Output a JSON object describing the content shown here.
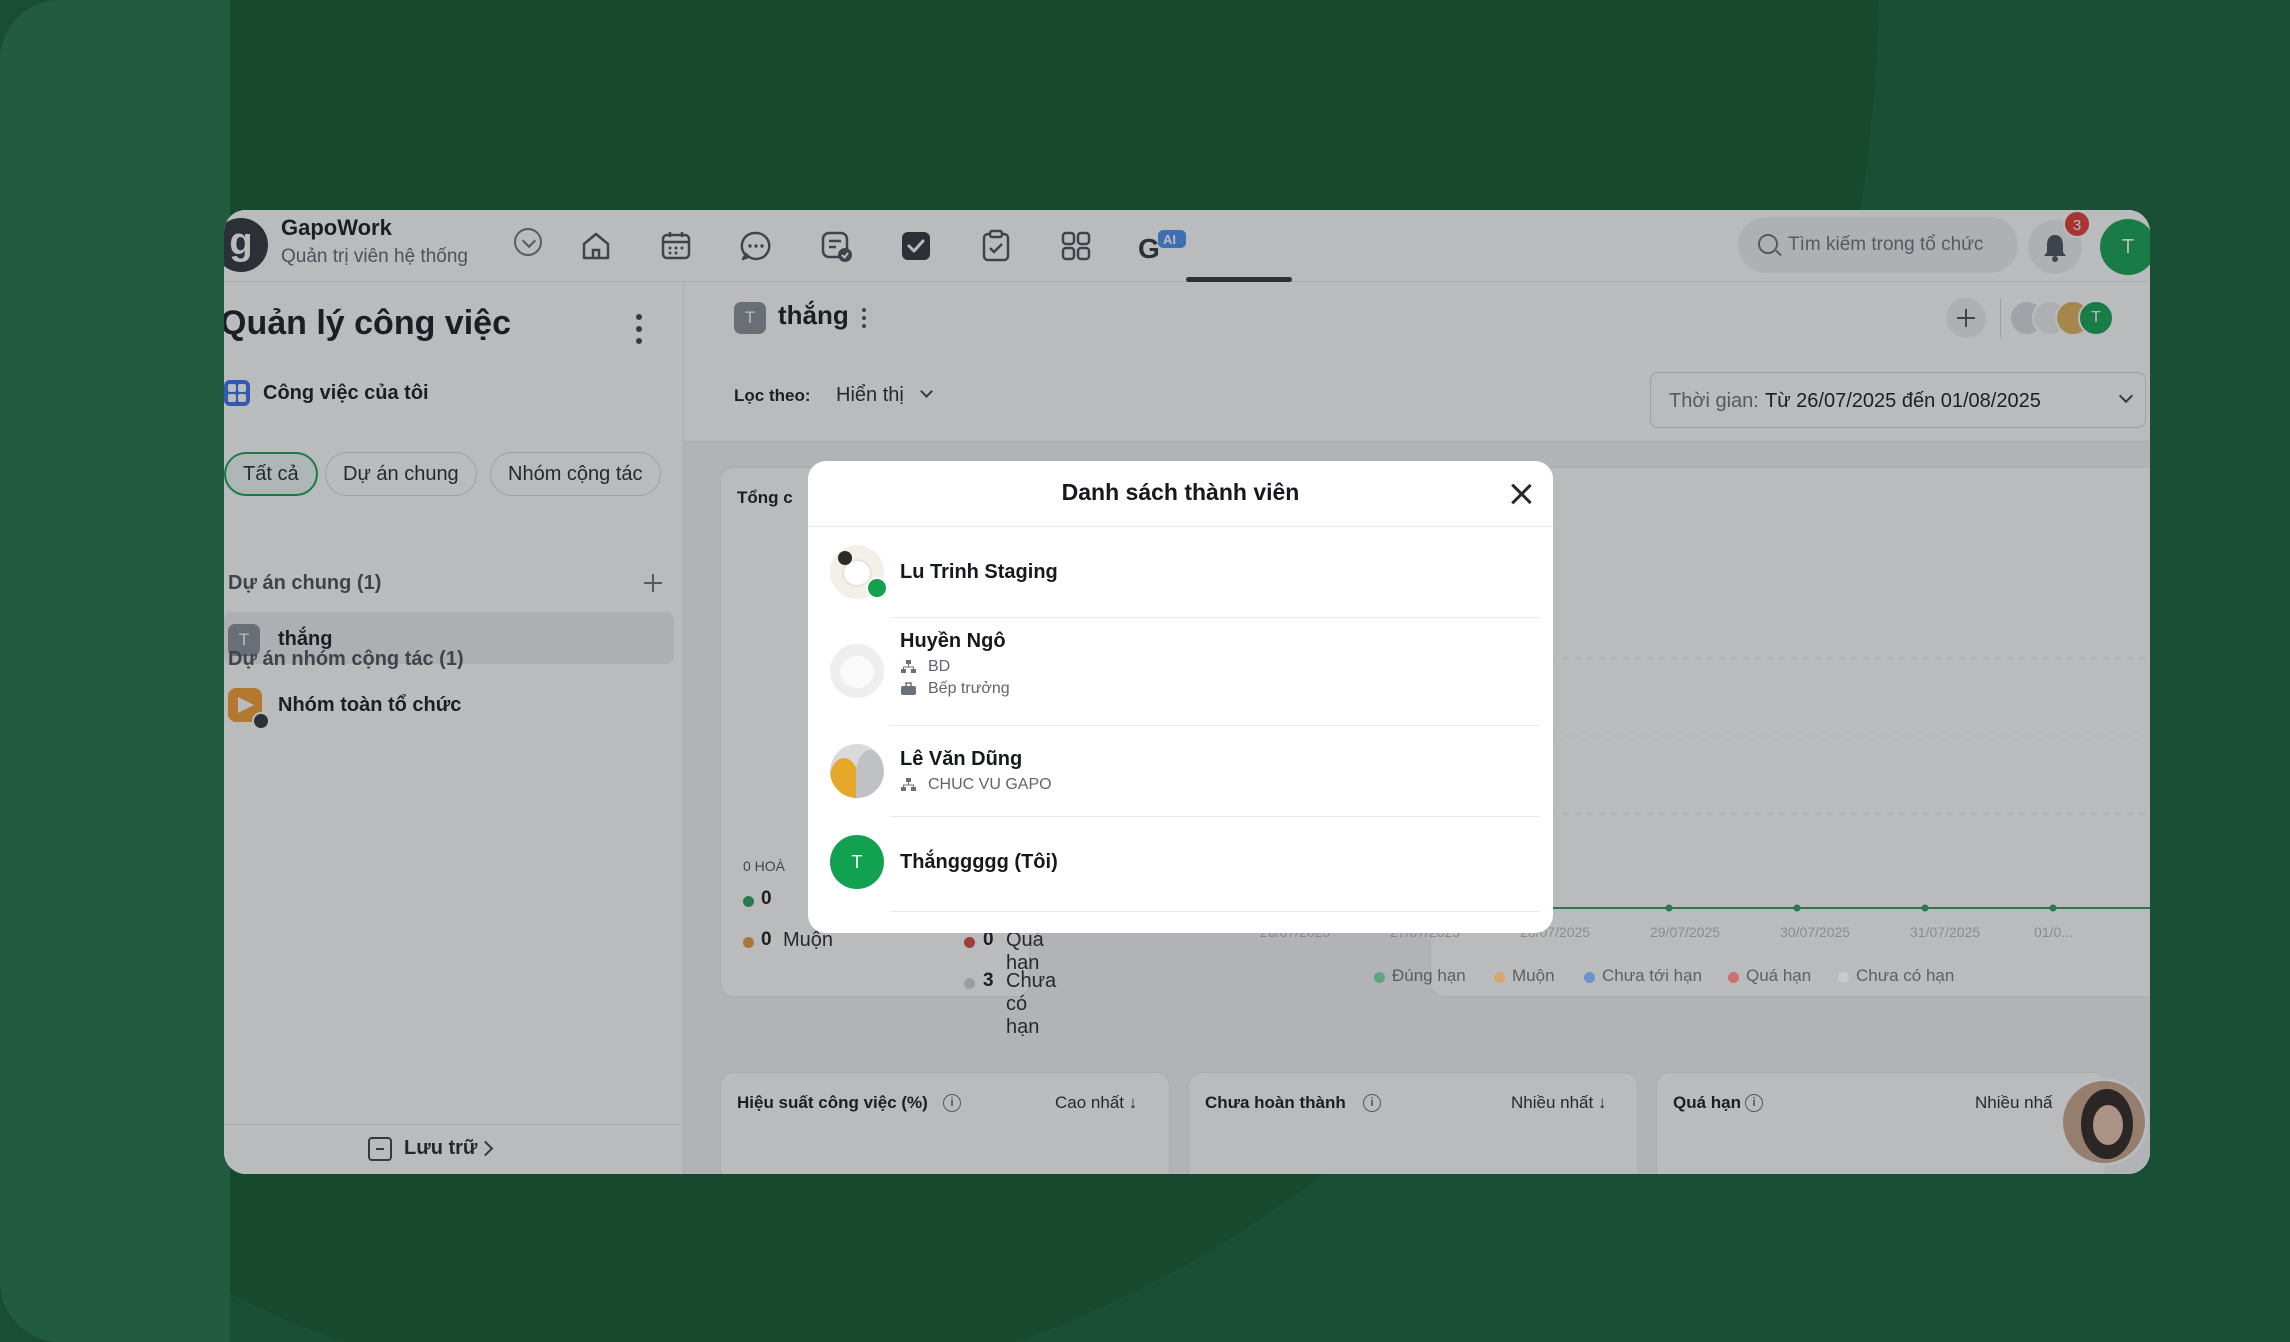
{
  "org": {
    "logo_letter": "g",
    "name": "GapoWork",
    "role": "Quản trị viên hệ thống"
  },
  "search": {
    "placeholder": "Tìm kiếm trong tổ chức"
  },
  "notifications": {
    "count": "3"
  },
  "nav": {
    "ai_label": "AI"
  },
  "user": {
    "avatar_letter": "T"
  },
  "sidebar": {
    "title": "Quản lý công việc",
    "my_tasks": "Công việc của tôi",
    "chips": [
      "Tất cả",
      "Dự án chung",
      "Nhóm cộng tác"
    ],
    "section_projects": "Dự án chung (1)",
    "project_badge": "T",
    "project_name": "thắng",
    "section_groups": "Dự án nhóm cộng tác (1)",
    "group_name": "Nhóm toàn tổ chức",
    "archive": "Lưu trữ"
  },
  "main": {
    "badge": "T",
    "title": "thắng",
    "member_letter": "T",
    "filter_label": "Lọc theo:",
    "filter_value": "Hiển thị",
    "date_label": "Thời gian:",
    "date_value": "Từ 26/07/2025 đến 01/08/2025",
    "summary_title_visible": "Tổng c",
    "summary_tag_visible": "0 HOÀ",
    "stats": {
      "dung_num": "0",
      "muon_num": "0",
      "muon_label": "Muộn",
      "quahan_num": "0",
      "quahan_label": "Quá hạn",
      "chuaco_num": "3",
      "chuaco_label": "Chưa có hạn"
    },
    "chart_axis": [
      "26/07/2025",
      "27/07/2025",
      "28/07/2025",
      "29/07/2025",
      "30/07/2025",
      "31/07/2025",
      "01/0..."
    ],
    "chart_legend": [
      "Đúng hạn",
      "Muộn",
      "Chưa tới hạn",
      "Quá hạn",
      "Chưa có hạn"
    ],
    "colors": {
      "dung": "#2e9b63",
      "muon": "#e79b3a",
      "chuatoi": "#3a7bd5",
      "quahan": "#d64545",
      "chuaco": "#d0d4d9"
    },
    "cards": [
      {
        "title": "Hiệu suất công việc (%)",
        "sort": "Cao nhất ↓"
      },
      {
        "title": "Chưa hoàn thành",
        "sort": "Nhiều nhất ↓"
      },
      {
        "title": "Quá hạn",
        "sort": "Nhiều nhấ"
      }
    ]
  },
  "modal": {
    "title": "Danh sách thành viên",
    "members": [
      {
        "name": "Lu Trinh Staging"
      },
      {
        "name": "Huyền Ngô",
        "dept": "BD",
        "position": "Bếp trưởng"
      },
      {
        "name": "Lê Văn Dũng",
        "dept": "CHUC VU GAPO"
      },
      {
        "name": "Thắnggggg (Tôi)",
        "avatar_letter": "T"
      }
    ]
  }
}
